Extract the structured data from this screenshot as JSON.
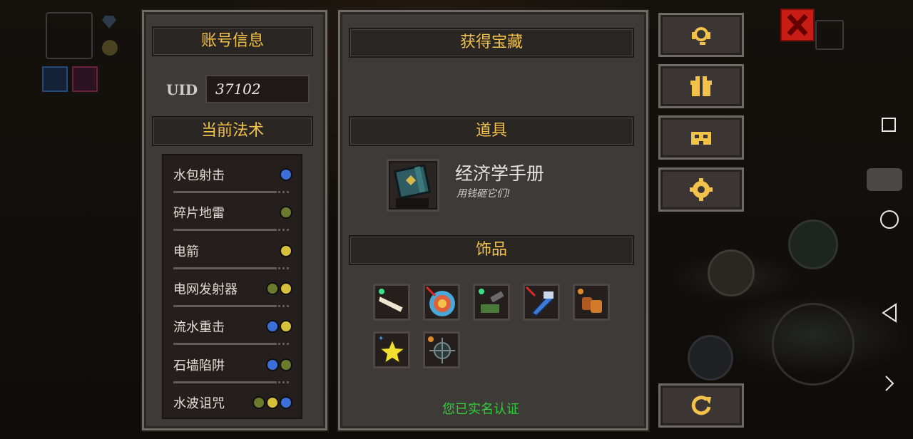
{
  "account": {
    "header": "账号信息",
    "uid_label": "UID",
    "uid_value": "37102"
  },
  "spells": {
    "header": "当前法术",
    "items": [
      {
        "name": "水包射击",
        "elements": [
          "water"
        ]
      },
      {
        "name": "碎片地雷",
        "elements": [
          "earth"
        ]
      },
      {
        "name": "电箭",
        "elements": [
          "thunder"
        ]
      },
      {
        "name": "电网发射器",
        "elements": [
          "earth",
          "thunder"
        ]
      },
      {
        "name": "流水重击",
        "elements": [
          "water",
          "thunder"
        ]
      },
      {
        "name": "石墙陷阱",
        "elements": [
          "water",
          "earth"
        ]
      },
      {
        "name": "水波诅咒",
        "elements": [
          "earth",
          "thunder",
          "water"
        ]
      }
    ]
  },
  "treasure": {
    "header": "获得宝藏",
    "props_header": "道具",
    "item_name": "经济学手册",
    "item_desc": "用钱砸它们!",
    "accessories_header": "饰品",
    "accessory_icons": [
      "bone-club-icon",
      "target-icon",
      "green-cannon-icon",
      "blue-hammer-icon",
      "orange-gloves-icon",
      "yellow-star-icon",
      "spiked-mine-icon"
    ],
    "verified": "您已实名认证"
  },
  "side_buttons": [
    "support-headset-icon",
    "gift-icon",
    "mask-icon",
    "settings-gear-icon",
    "refresh-icon"
  ],
  "colors": {
    "header_gold": "#f2c24a",
    "verified_green": "#2fce3a",
    "panel_bg": "#3e3a38",
    "close_red": "#d0201a"
  }
}
